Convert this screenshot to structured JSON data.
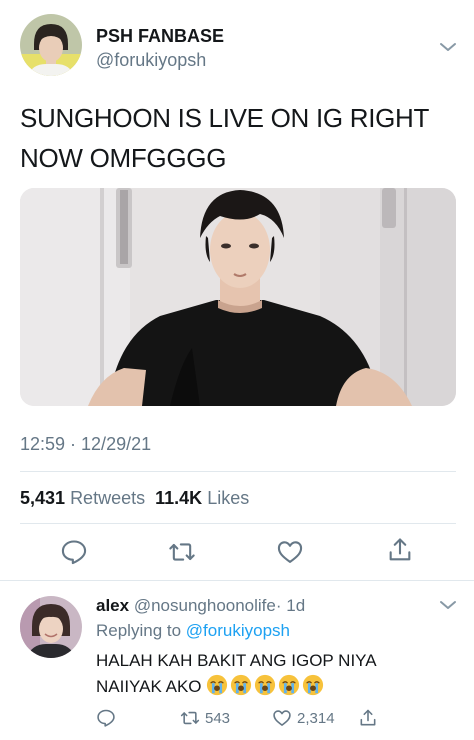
{
  "tweet": {
    "display_name": "PSH FANBASE",
    "handle": "@forukiyopsh",
    "text": "SUNGHOON IS LIVE ON IG RIGHT NOW OMFGGGG",
    "timestamp": "12:59 · 12/29/21",
    "retweets_count": "5,431",
    "retweets_label": "Retweets",
    "likes_count": "11.4K",
    "likes_label": "Likes",
    "icons": [
      "reply-icon",
      "retweet-icon",
      "like-icon",
      "share-icon",
      "chevron-down-icon"
    ]
  },
  "reply": {
    "name": "alex",
    "handle": "@nosunghoonolife",
    "age": "· 1d",
    "replying_prefix": "Replying to",
    "replying_to": "@forukiyopsh",
    "text": "HALAH KAH BAKIT ANG IGOP NIYA NAIIYAK AKO",
    "emoji": "crying-face",
    "emoji_count": 5,
    "retweets": "543",
    "likes": "2,314"
  },
  "colors": {
    "text": "#14171a",
    "secondary": "#657786",
    "link": "#1da1f2",
    "divider": "#e1e8ed"
  }
}
